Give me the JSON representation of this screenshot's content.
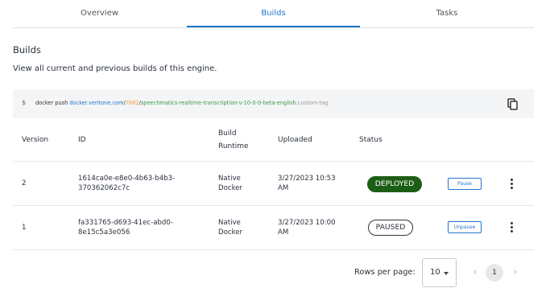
{
  "tabs": [
    {
      "label": "Overview"
    },
    {
      "label": "Builds"
    },
    {
      "label": "Tasks"
    }
  ],
  "active_tab": "Builds",
  "section": {
    "title": "Builds",
    "description": "View all current and previous builds of this engine."
  },
  "command": {
    "prompt": "$",
    "base": "docker push ",
    "registry": "docker.veritone.com",
    "sep1": "/",
    "org": "7682",
    "sep2": "/",
    "repo": "speechmatics-realtime-transcription-v-10-0-0-beta-english",
    "tag": ":custom-tag",
    "copy_icon": "copy-icon"
  },
  "table": {
    "headers": {
      "version": "Version",
      "id": "ID",
      "runtime_l1": "Build",
      "runtime_l2": "Runtime",
      "uploaded": "Uploaded",
      "status": "Status"
    },
    "rows": [
      {
        "version": "2",
        "id_l1": "1614ca0e-e8e0-4b63-b4b3-",
        "id_l2": "370362062c7c",
        "runtime_l1": "Native",
        "runtime_l2": "Docker",
        "uploaded_l1": "3/27/2023 10:53",
        "uploaded_l2": "AM",
        "status": "DEPLOYED",
        "action": "Pause"
      },
      {
        "version": "1",
        "id_l1": "fa331765-d693-41ec-abd0-",
        "id_l2": "8e15c5a3e056",
        "runtime_l1": "Native",
        "runtime_l2": "Docker",
        "uploaded_l1": "3/27/2023 10:00",
        "uploaded_l2": "AM",
        "status": "PAUSED",
        "action": "Unpause"
      }
    ]
  },
  "pagination": {
    "rows_per_page_label": "Rows per page:",
    "rows_per_page": "10",
    "current_page": "1",
    "prev_icon": "chevron-left-icon",
    "next_icon": "chevron-right-icon"
  },
  "colors": {
    "accent": "#1f76c9",
    "deployed": "#1d5e16",
    "org": "#f0a037",
    "repo": "#3a9a4a"
  }
}
